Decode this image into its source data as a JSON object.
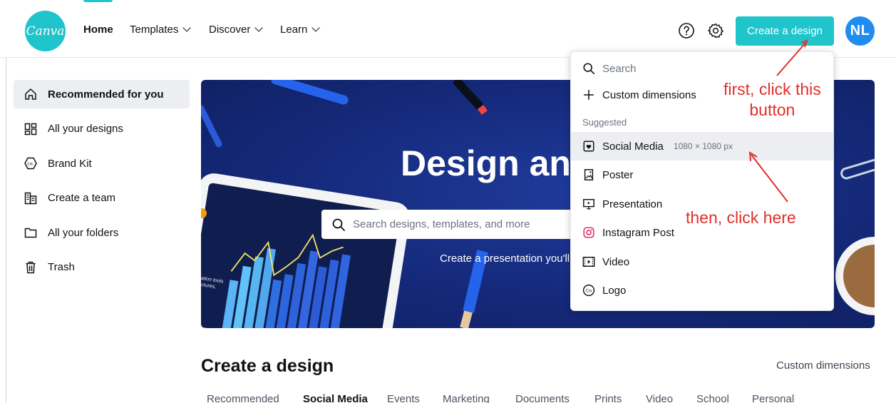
{
  "header": {
    "logo_text": "Canva",
    "nav": [
      {
        "label": "Home",
        "active": true
      },
      {
        "label": "Templates"
      },
      {
        "label": "Discover"
      },
      {
        "label": "Learn"
      }
    ],
    "icons": [
      "help-icon",
      "settings-icon"
    ],
    "create_button": "Create a design",
    "avatar_initials": "NL",
    "accent_color": "#20c4cb",
    "avatar_color": "#1f8cf0"
  },
  "sidebar": {
    "items": [
      {
        "label": "Recommended for you",
        "icon": "home-icon",
        "active": true
      },
      {
        "label": "All your designs",
        "icon": "grid-icon"
      },
      {
        "label": "Brand Kit",
        "icon": "brand-kit-icon"
      },
      {
        "label": "Create a team",
        "icon": "team-icon"
      },
      {
        "label": "All your folders",
        "icon": "folder-icon"
      },
      {
        "label": "Trash",
        "icon": "trash-icon"
      }
    ]
  },
  "hero": {
    "title": "Design any",
    "search_placeholder": "Search designs, templates, and more",
    "subtitle": "Create a presentation you'll",
    "tablet_caption": "cation tools lectures,"
  },
  "dropdown": {
    "search_placeholder": "Search",
    "custom_dimensions": "Custom dimensions",
    "section_label": "Suggested",
    "items": [
      {
        "label": "Social Media",
        "detail": "1080 × 1080 px",
        "icon": "social-media-icon",
        "highlighted": true
      },
      {
        "label": "Poster",
        "icon": "poster-icon"
      },
      {
        "label": "Presentation",
        "icon": "presentation-icon"
      },
      {
        "label": "Instagram Post",
        "icon": "instagram-icon",
        "icon_color": "#e1306c"
      },
      {
        "label": "Video",
        "icon": "video-icon"
      },
      {
        "label": "Logo",
        "icon": "logo-icon"
      }
    ]
  },
  "annotations": {
    "first": "first, click this\nbutton",
    "then": "then, click here",
    "color": "#e0302a"
  },
  "create_section": {
    "title": "Create a design",
    "custom_link": "Custom dimensions",
    "tabs": [
      "Recommended",
      "Social Media",
      "Events",
      "Marketing",
      "Documents",
      "Prints",
      "Video",
      "School",
      "Personal"
    ],
    "active_tab": "Social Media"
  }
}
